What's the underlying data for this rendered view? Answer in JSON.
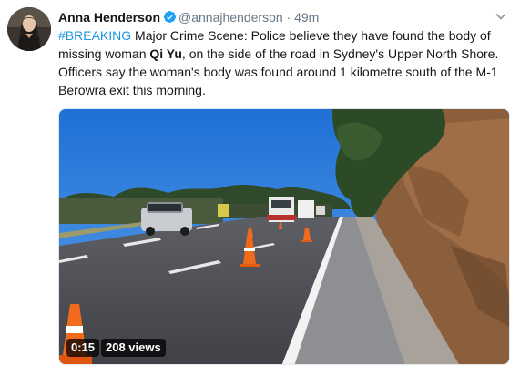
{
  "author": {
    "name": "Anna Henderson",
    "handle": "@annajhenderson",
    "separator": "·",
    "time": "49m"
  },
  "tweet": {
    "hashtag": "#BREAKING",
    "text_part1": " Major Crime Scene: Police believe they have found the body of missing woman ",
    "bold_name": "Qi Yu",
    "text_part2": ", on the side of the road in Sydney's Upper North Shore. Officers say the woman's body was found around 1 kilometre south of the M-1 Berowra exit this morning."
  },
  "video": {
    "duration": "0:15",
    "views": "208 views"
  },
  "colors": {
    "link": "#1b95e0",
    "verified": "#1da1f2",
    "secondary_text": "#657786"
  },
  "icons": {
    "verified": "verified-badge-icon",
    "menu": "chevron-down-icon"
  }
}
